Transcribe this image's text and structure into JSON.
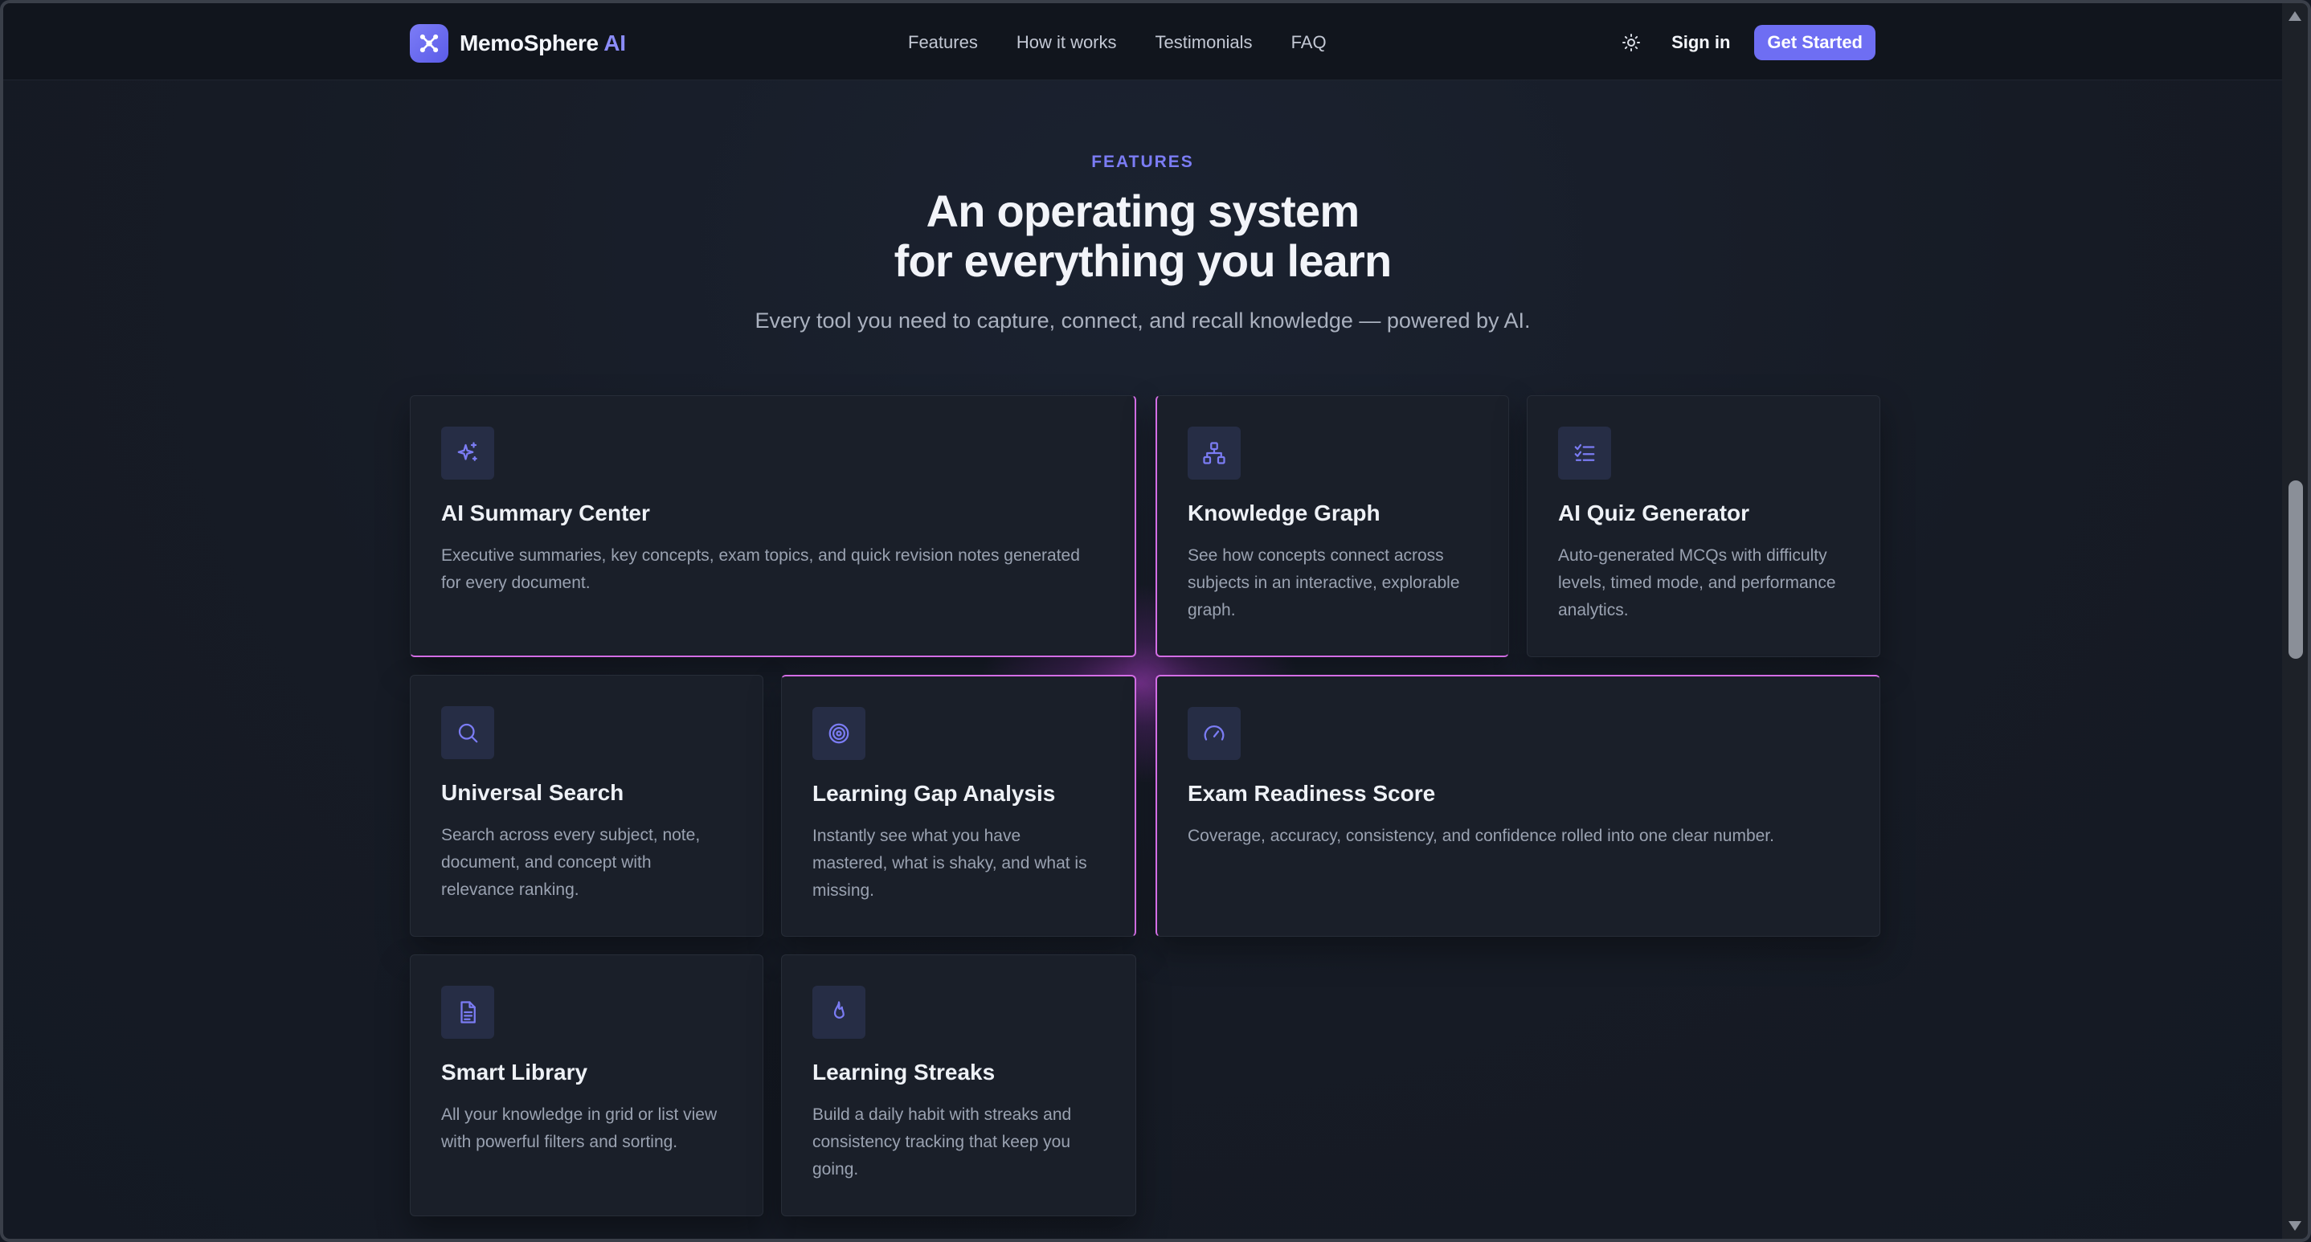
{
  "nav": {
    "brand_name": "MemoSphere",
    "brand_suffix": "AI",
    "links": [
      "Features",
      "How it works",
      "Testimonials",
      "FAQ"
    ],
    "sign_in": "Sign in",
    "cta": "Get Started"
  },
  "section": {
    "eyebrow": "FEATURES",
    "headline_line1": "An operating system",
    "headline_line2": "for everything you learn",
    "subhead": "Every tool you need to capture, connect, and recall knowledge — powered by AI."
  },
  "features": [
    {
      "icon": "sparkles-icon",
      "title": "AI Summary Center",
      "desc_lines": [
        "Executive summaries, key concepts, exam topics, and quick revision notes generated",
        "for every document."
      ]
    },
    {
      "icon": "network-icon",
      "title": "Knowledge Graph",
      "desc_lines": [
        "See how concepts connect across",
        "subjects in an interactive, explorable",
        "graph."
      ]
    },
    {
      "icon": "checklist-icon",
      "title": "AI Quiz Generator",
      "desc_lines": [
        "Auto-generated MCQs with difficulty",
        "levels, timed mode, and performance",
        "analytics."
      ]
    },
    {
      "icon": "search-icon",
      "title": "Universal Search",
      "desc_lines": [
        "Search across every subject, note,",
        "document, and concept with",
        "relevance ranking."
      ]
    },
    {
      "icon": "target-icon",
      "title": "Learning Gap Analysis",
      "desc_lines": [
        "Instantly see what you have",
        "mastered, what is shaky, and what is",
        "missing."
      ]
    },
    {
      "icon": "gauge-icon",
      "title": "Exam Readiness Score",
      "desc_lines": [
        "Coverage, accuracy, consistency, and confidence rolled into one clear number."
      ]
    },
    {
      "icon": "document-icon",
      "title": "Smart Library",
      "desc_lines": [
        "All your knowledge in grid or list view",
        "with powerful filters and sorting."
      ]
    },
    {
      "icon": "flame-icon",
      "title": "Learning Streaks",
      "desc_lines": [
        "Build a daily habit with streaks and",
        "consistency tracking that keep you",
        "going."
      ]
    }
  ],
  "colors": {
    "accent": "#6e6ef3",
    "glow": "#d46ee6",
    "background": "#151a24"
  }
}
